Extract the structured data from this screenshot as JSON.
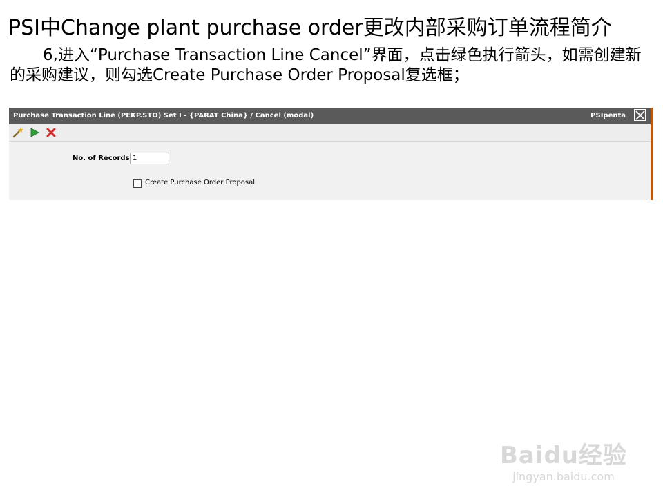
{
  "slide": {
    "title": "PSI中Change plant purchase order更改内部采购订单流程简介",
    "step_text": "6,进入“Purchase Transaction Line Cancel”界面，点击绿色执行箭头，如需创建新的采购建议，则勾选Create Purchase Order Proposal复选框；"
  },
  "window": {
    "title": "Purchase Transaction Line (PEKP.STO) Set I - {PARAT China} / Cancel (modal)",
    "brand": "PSIpenta",
    "titlebar_color": "#5a5a5a",
    "accent_border_color": "#b65a12"
  },
  "toolbar": {
    "icons": [
      "magic-wand-icon",
      "execute-arrow-icon",
      "cancel-x-icon"
    ],
    "execute_color": "#2e9e3a",
    "cancel_color": "#d32a2a"
  },
  "form": {
    "records_label": "No. of Records:",
    "records_value": "1",
    "checkbox_label": "Create Purchase Order Proposal",
    "checkbox_checked": false
  },
  "watermark": {
    "logo": "Baidu经验",
    "url": "jingyan.baidu.com"
  }
}
